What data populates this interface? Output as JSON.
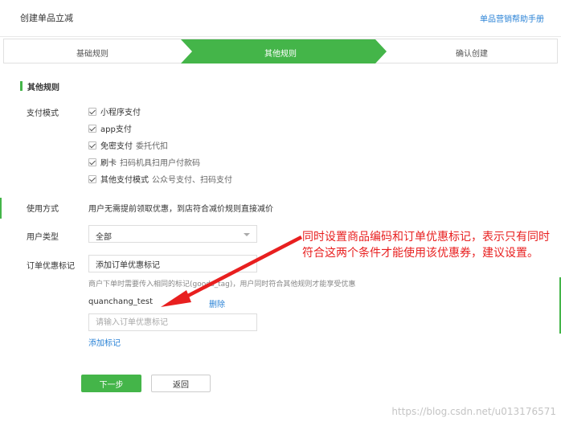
{
  "header": {
    "title": "创建单品立减",
    "help_link": "单品营销帮助手册"
  },
  "steps": [
    {
      "label": "基础规则",
      "active": false
    },
    {
      "label": "其他规则",
      "active": true
    },
    {
      "label": "确认创建",
      "active": false
    }
  ],
  "section": {
    "title": "其他规则"
  },
  "payment": {
    "label": "支付模式",
    "options": [
      {
        "label": "小程序支付",
        "note": "",
        "checked": true
      },
      {
        "label": "app支付",
        "note": "",
        "checked": true
      },
      {
        "label": "免密支付",
        "note": "委托代扣",
        "checked": true
      },
      {
        "label": "刷卡",
        "note": "扫码机具扫用户付款码",
        "checked": true
      },
      {
        "label": "其他支付模式",
        "note": "公众号支付、扫码支付",
        "checked": true
      }
    ]
  },
  "usage": {
    "label": "使用方式",
    "text": "用户无需提前领取优惠，到店符合减价规则直接减价"
  },
  "user_type": {
    "label": "用户类型",
    "value": "全部"
  },
  "order_tag": {
    "label": "订单优惠标记",
    "input_value": "添加订单优惠标记",
    "hint": "商户下单时需要传入相同的标记(goods_tag)，用户同时符合其他规则才能享受优惠",
    "tag": "quanchang_test",
    "delete_label": "删除",
    "new_placeholder": "请输入订单优惠标记",
    "add_label": "添加标记"
  },
  "actions": {
    "next": "下一步",
    "back": "返回"
  },
  "annotation": "同时设置商品编码和订单优惠标记，表示只有同时符合这两个条件才能使用该优惠券，建议设置。",
  "watermark": "https://blog.csdn.net/u013176571",
  "colors": {
    "primary": "#44b549",
    "link": "#2b83d6",
    "annotation": "#e81f1f"
  }
}
